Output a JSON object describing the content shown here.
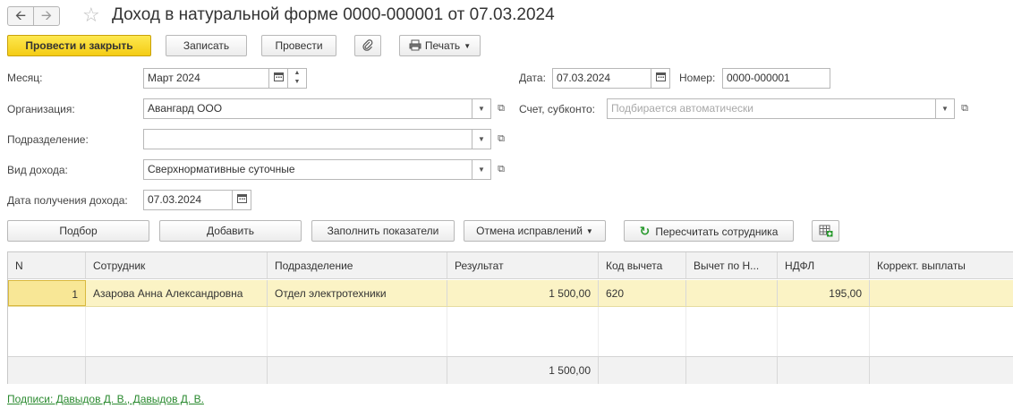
{
  "window": {
    "title": "Доход в натуральной форме 0000-000001 от 07.03.2024"
  },
  "icons": {
    "back": "arrow-left-icon",
    "forward": "arrow-right-icon",
    "favorite": "star-icon",
    "attach": "paperclip-icon",
    "print": "printer-icon",
    "refresh": "refresh-icon",
    "table_settings": "table-add-icon"
  },
  "toolbar": {
    "post_close": "Провести и закрыть",
    "save": "Записать",
    "post": "Провести",
    "print": "Печать"
  },
  "form": {
    "month_label": "Месяц:",
    "month_value": "Март 2024",
    "date_label": "Дата:",
    "date_value": "07.03.2024",
    "number_label": "Номер:",
    "number_value": "0000-000001",
    "org_label": "Организация:",
    "org_value": "Авангард ООО",
    "account_label": "Счет, субконто:",
    "account_placeholder": "Подбирается автоматически",
    "dept_label": "Подразделение:",
    "dept_value": "",
    "income_type_label": "Вид дохода:",
    "income_type_value": "Сверхнормативные суточные",
    "income_date_label": "Дата получения дохода:",
    "income_date_value": "07.03.2024"
  },
  "table_toolbar": {
    "pick": "Подбор",
    "add": "Добавить",
    "fill": "Заполнить показатели",
    "cancel_fix": "Отмена исправлений",
    "recalc": "Пересчитать сотрудника"
  },
  "table": {
    "columns": [
      "N",
      "Сотрудник",
      "Подразделение",
      "Результат",
      "Код вычета",
      "Вычет по Н...",
      "НДФЛ",
      "Коррект. выплаты"
    ],
    "rows": [
      [
        "1",
        "Азарова Анна Александровна",
        "Отдел электротехники",
        "1 500,00",
        "620",
        "",
        "195,00",
        ""
      ]
    ],
    "totals": [
      "",
      "",
      "",
      "1 500,00",
      "",
      "",
      "",
      ""
    ]
  },
  "footer": {
    "signatures": "Подписи: Давыдов Д. В., Давыдов Д. В."
  },
  "colors": {
    "primary_button": "#f4cc15",
    "selected_row": "#fbf3c5",
    "link": "#2a8a2f"
  }
}
